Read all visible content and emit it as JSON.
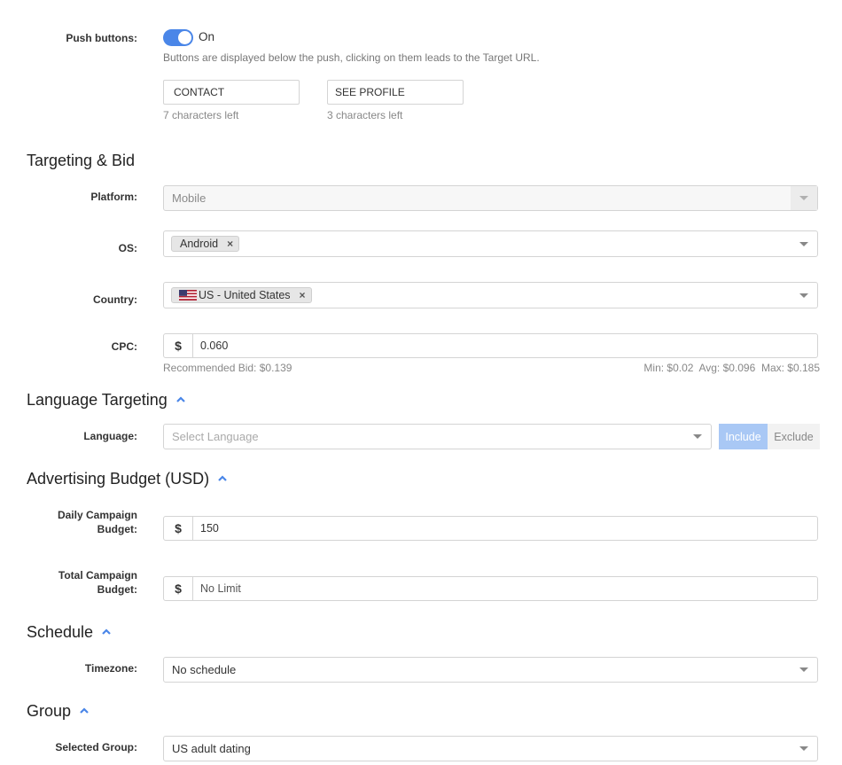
{
  "push": {
    "label": "Push buttons:",
    "toggle_state": "On",
    "description": "Buttons are displayed below the push, clicking on them leads to the Target URL.",
    "buttons": [
      {
        "value": "CONTACT",
        "hint": "7 characters left"
      },
      {
        "value": "SEE PROFILE",
        "hint": "3 characters left"
      }
    ]
  },
  "targeting": {
    "title": "Targeting & Bid",
    "platform": {
      "label": "Platform:",
      "value": "Mobile"
    },
    "os": {
      "label": "OS:",
      "tag": "Android",
      "remove": "×"
    },
    "country": {
      "label": "Country:",
      "tag": "US - United States",
      "remove": "×"
    },
    "cpc": {
      "label": "CPC:",
      "currency": "$",
      "value": "0.060",
      "recommended": "Recommended Bid: $0.139",
      "stats": "Min: $0.02  Avg: $0.096  Max: $0.185"
    }
  },
  "language": {
    "title": "Language Targeting",
    "label": "Language:",
    "placeholder": "Select Language",
    "include": "Include",
    "exclude": "Exclude"
  },
  "budget": {
    "title": "Advertising Budget (USD)",
    "daily": {
      "label_line1": "Daily Campaign",
      "label_line2": "Budget:",
      "currency": "$",
      "value": "150"
    },
    "total": {
      "label_line1": "Total Campaign",
      "label_line2": "Budget:",
      "currency": "$",
      "value": "No Limit"
    }
  },
  "schedule": {
    "title": "Schedule",
    "label": "Timezone:",
    "value": "No schedule"
  },
  "group": {
    "title": "Group",
    "label": "Selected Group:",
    "value": "US adult dating"
  },
  "colors": {
    "accent": "#4a86e8",
    "include_bg": "#a9c8f5",
    "exclude_bg": "#f2f2f2"
  }
}
